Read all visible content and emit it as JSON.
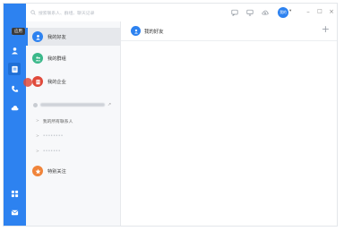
{
  "colors": {
    "rail": "#2d82f0",
    "rail_active": "#1f6fd6",
    "panel": "#f7f8fa",
    "friends_icon": "#2d82f0",
    "groups_icon": "#3bb88a",
    "contacts_icon": "#e04a3b",
    "special_icon": "#f0843a"
  },
  "rail": {
    "tooltip": "应用",
    "icons": [
      "chat-icon",
      "contacts-icon",
      "apps-icon",
      "phone-icon",
      "cloud-icon",
      "grid-icon",
      "mail-icon"
    ]
  },
  "topbar": {
    "search_placeholder": "搜索联系人、群组、聊天记录",
    "avatar_text": "我的",
    "avatar_caret": "▾",
    "minimize": "–",
    "maximize": "□",
    "close": "×"
  },
  "sidebar": {
    "items": [
      {
        "label": "我的好友",
        "icon": "friends-icon"
      },
      {
        "label": "我的群组",
        "icon": "group-icon"
      },
      {
        "label": "我的企业",
        "icon": "enterprise-icon"
      }
    ],
    "group_arrow": "↗",
    "sub_items": [
      {
        "label": "我的所有联系人",
        "chevron": ">"
      },
      {
        "label": "••••••••",
        "chevron": ">"
      },
      {
        "label": "•••••••",
        "chevron": ">"
      }
    ],
    "special": {
      "label": "特别关注",
      "icon": "star-icon"
    }
  },
  "main": {
    "title": "我的好友",
    "add": "+"
  }
}
